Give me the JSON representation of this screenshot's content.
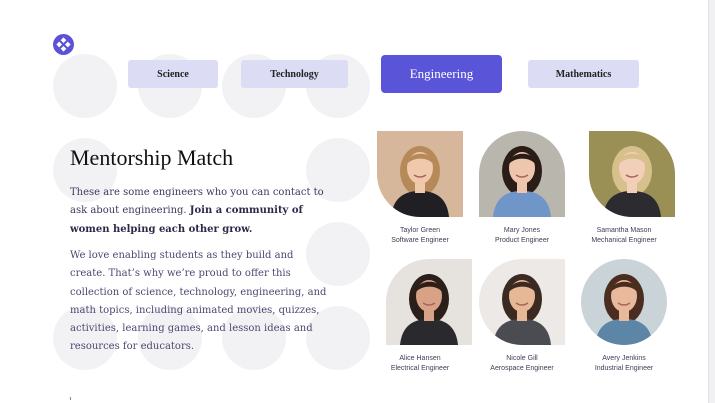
{
  "tabs": [
    {
      "label": "Science",
      "active": false
    },
    {
      "label": "Technology",
      "active": false
    },
    {
      "label": "Engineering",
      "active": true
    },
    {
      "label": "Mathematics",
      "active": false
    }
  ],
  "heading": "Mentorship Match",
  "intro": {
    "text": "These are some engineers who you can contact to ask about engineering. ",
    "bold": "Join a community of women helping each other grow."
  },
  "body_text": "We love enabling students as they build and create. That’s why we’re proud to offer this collection of science, technology, engineering, and math topics, including animated movies, quizzes, activities, learning games, and lesson ideas and resources for educators.",
  "mentors": [
    {
      "name": "Taylor Green",
      "role": "Software Engineer",
      "bg": "#d6b79b",
      "hair": "#b58a58",
      "skin": "#f0c9ad",
      "shirt": "#1f1f24"
    },
    {
      "name": "Mary Jones",
      "role": "Product Engineer",
      "bg": "#b9b6ae",
      "hair": "#2a1d17",
      "skin": "#eec6ae",
      "shirt": "#6f95c9"
    },
    {
      "name": "Samantha Mason",
      "role": "Mechanical Engineer",
      "bg": "#9a8f55",
      "hair": "#d8c08d",
      "skin": "#f2cfb8",
      "shirt": "#2b2b30"
    },
    {
      "name": "Alice Hansen",
      "role": "Electrical Engineer",
      "bg": "#e6e3df",
      "hair": "#2b1f1a",
      "skin": "#d7a285",
      "shirt": "#2a2a2e"
    },
    {
      "name": "Nicole Gill",
      "role": "Aerospace Engineer",
      "bg": "#ece9e6",
      "hair": "#3a2a22",
      "skin": "#e7b896",
      "shirt": "#4b4b52"
    },
    {
      "name": "Avery Jenkins",
      "role": "Industrial Engineer",
      "bg": "#c9d3d8",
      "hair": "#4a2d1f",
      "skin": "#e8b99a",
      "shirt": "#5d86a6"
    }
  ],
  "colors": {
    "accent": "#5a54d8",
    "tab_bg": "#dcdcf4",
    "circle": "#f2f2f5"
  }
}
